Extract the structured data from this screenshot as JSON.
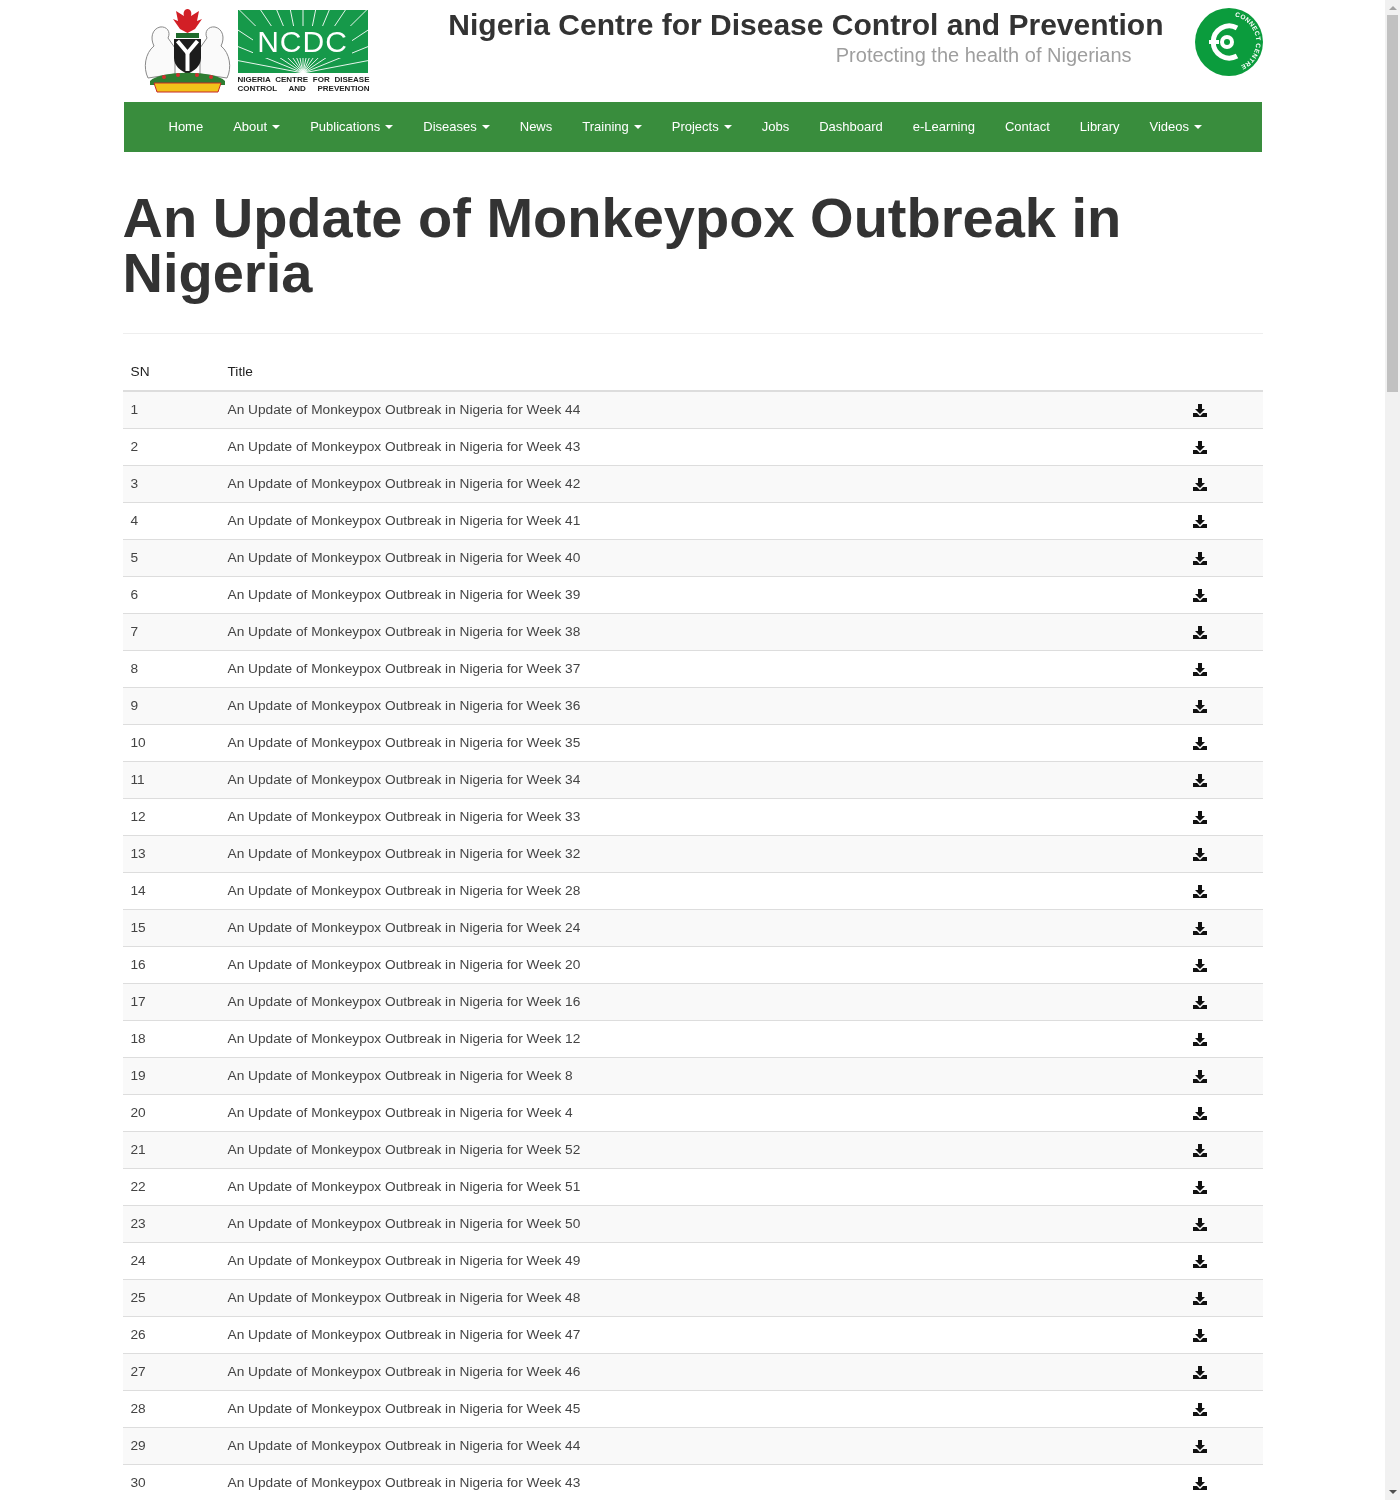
{
  "header": {
    "logo": {
      "wordmark": "NCDC",
      "caption_lines": [
        "NIGERIA CENTRE FOR DISEASE",
        "CONTROL AND PREVENTION"
      ]
    },
    "title": "Nigeria Centre for Disease Control and Prevention",
    "subtitle": "Protecting the health of Nigerians",
    "badge": {
      "caption": "CONNECT CENTRE"
    }
  },
  "nav": [
    {
      "label": "Home",
      "dropdown": false
    },
    {
      "label": "About",
      "dropdown": true
    },
    {
      "label": "Publications",
      "dropdown": true
    },
    {
      "label": "Diseases",
      "dropdown": true
    },
    {
      "label": "News",
      "dropdown": false
    },
    {
      "label": "Training",
      "dropdown": true
    },
    {
      "label": "Projects",
      "dropdown": true
    },
    {
      "label": "Jobs",
      "dropdown": false
    },
    {
      "label": "Dashboard",
      "dropdown": false
    },
    {
      "label": "e-Learning",
      "dropdown": false
    },
    {
      "label": "Contact",
      "dropdown": false
    },
    {
      "label": "Library",
      "dropdown": false
    },
    {
      "label": "Videos",
      "dropdown": true
    }
  ],
  "heading": "An Update of Monkeypox Outbreak in Nigeria",
  "table": {
    "columns": [
      "SN",
      "Title"
    ],
    "rows": [
      {
        "sn": "1",
        "title": "An Update of Monkeypox Outbreak in Nigeria for Week 44"
      },
      {
        "sn": "2",
        "title": "An Update of Monkeypox Outbreak in Nigeria for Week 43"
      },
      {
        "sn": "3",
        "title": "An Update of Monkeypox Outbreak in Nigeria for Week 42"
      },
      {
        "sn": "4",
        "title": "An Update of Monkeypox Outbreak in Nigeria for Week 41"
      },
      {
        "sn": "5",
        "title": "An Update of Monkeypox Outbreak in Nigeria for Week 40"
      },
      {
        "sn": "6",
        "title": "An Update of Monkeypox Outbreak in Nigeria for Week 39"
      },
      {
        "sn": "7",
        "title": "An Update of Monkeypox Outbreak in Nigeria for Week 38"
      },
      {
        "sn": "8",
        "title": "An Update of Monkeypox Outbreak in Nigeria for Week 37"
      },
      {
        "sn": "9",
        "title": "An Update of Monkeypox Outbreak in Nigeria for Week 36"
      },
      {
        "sn": "10",
        "title": "An Update of Monkeypox Outbreak in Nigeria for Week 35"
      },
      {
        "sn": "11",
        "title": "An Update of Monkeypox Outbreak in Nigeria for Week 34"
      },
      {
        "sn": "12",
        "title": "An Update of Monkeypox Outbreak in Nigeria for Week 33"
      },
      {
        "sn": "13",
        "title": "An Update of Monkeypox Outbreak in Nigeria for Week 32"
      },
      {
        "sn": "14",
        "title": "An Update of Monkeypox Outbreak in Nigeria for Week 28"
      },
      {
        "sn": "15",
        "title": "An Update of Monkeypox Outbreak in Nigeria for Week 24"
      },
      {
        "sn": "16",
        "title": "An Update of Monkeypox Outbreak in Nigeria for Week 20"
      },
      {
        "sn": "17",
        "title": "An Update of Monkeypox Outbreak in Nigeria for Week 16"
      },
      {
        "sn": "18",
        "title": "An Update of Monkeypox Outbreak in Nigeria for Week 12"
      },
      {
        "sn": "19",
        "title": "An Update of Monkeypox Outbreak in Nigeria for Week 8"
      },
      {
        "sn": "20",
        "title": "An Update of Monkeypox Outbreak in Nigeria for Week 4"
      },
      {
        "sn": "21",
        "title": "An Update of Monkeypox Outbreak in Nigeria for Week 52"
      },
      {
        "sn": "22",
        "title": "An Update of Monkeypox Outbreak in Nigeria for Week 51"
      },
      {
        "sn": "23",
        "title": "An Update of Monkeypox Outbreak in Nigeria for Week 50"
      },
      {
        "sn": "24",
        "title": "An Update of Monkeypox Outbreak in Nigeria for Week 49"
      },
      {
        "sn": "25",
        "title": "An Update of Monkeypox Outbreak in Nigeria for Week 48"
      },
      {
        "sn": "26",
        "title": "An Update of Monkeypox Outbreak in Nigeria for Week 47"
      },
      {
        "sn": "27",
        "title": "An Update of Monkeypox Outbreak in Nigeria for Week 46"
      },
      {
        "sn": "28",
        "title": "An Update of Monkeypox Outbreak in Nigeria for Week 45"
      },
      {
        "sn": "29",
        "title": "An Update of Monkeypox Outbreak in Nigeria for Week 44"
      },
      {
        "sn": "30",
        "title": "An Update of Monkeypox Outbreak in Nigeria for Week 43"
      }
    ]
  }
}
